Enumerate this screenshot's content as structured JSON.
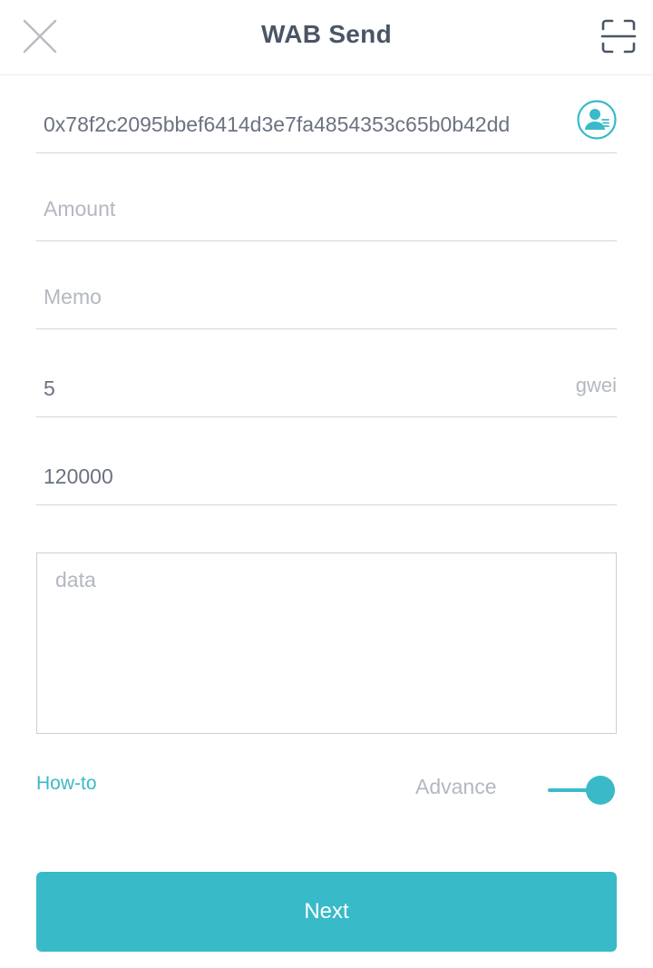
{
  "header": {
    "title": "WAB Send",
    "close_icon": "close-icon",
    "scan_icon": "scan-qr-icon"
  },
  "form": {
    "address": {
      "value": "0x78f2c2095bbef6414d3e7fa4854353c65b0b42dd",
      "contact_icon": "contact-book-icon"
    },
    "amount": {
      "value": "",
      "placeholder": "Amount"
    },
    "memo": {
      "value": "",
      "placeholder": "Memo"
    },
    "gas_price": {
      "value": "5",
      "unit": "gwei"
    },
    "gas_limit": {
      "value": "120000"
    },
    "data": {
      "value": "",
      "placeholder": "data"
    }
  },
  "options": {
    "howto_label": "How-to",
    "advance_label": "Advance",
    "advance_enabled": true
  },
  "actions": {
    "next_label": "Next"
  },
  "colors": {
    "accent": "#38bac9",
    "title": "#4a5566",
    "placeholder": "#b3b8c0",
    "divider": "#d7d7d7"
  }
}
